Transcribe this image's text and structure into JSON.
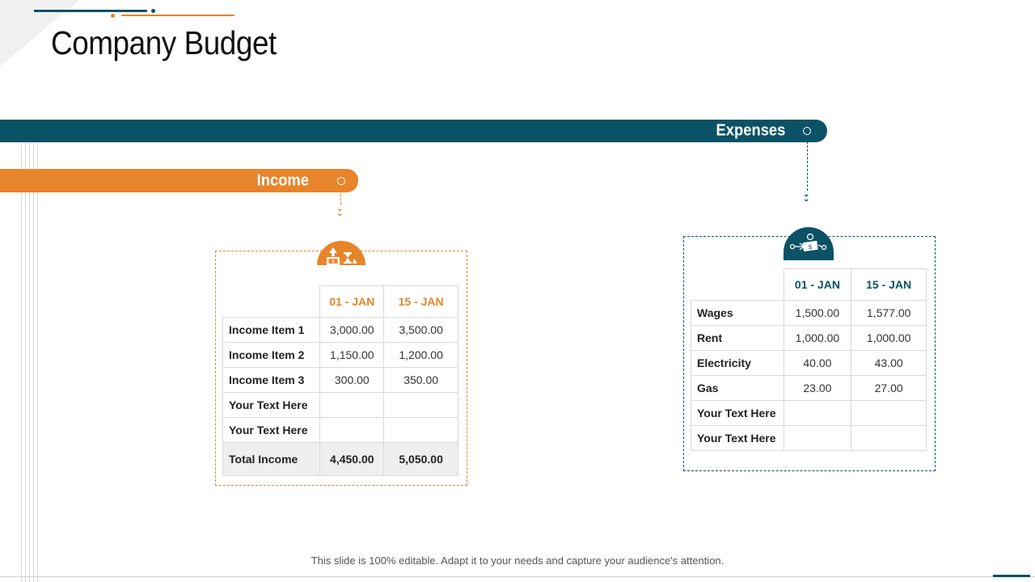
{
  "title": "Company Budget",
  "colors": {
    "teal": "#0b5266",
    "orange": "#e8842a"
  },
  "expenses": {
    "label": "Expenses",
    "icon": "money-flying-icon",
    "columns": [
      "01 - JAN",
      "15 - JAN"
    ],
    "rows": [
      {
        "label": "Wages",
        "values": [
          "1,500.00",
          "1,577.00"
        ]
      },
      {
        "label": "Rent",
        "values": [
          "1,000.00",
          "1,000.00"
        ]
      },
      {
        "label": "Electricity",
        "values": [
          "40.00",
          "43.00"
        ]
      },
      {
        "label": "Gas",
        "values": [
          "23.00",
          "27.00"
        ]
      },
      {
        "label": "Your Text Here",
        "values": [
          "",
          ""
        ]
      },
      {
        "label": "Your Text Here",
        "values": [
          "",
          ""
        ]
      }
    ]
  },
  "income": {
    "label": "Income",
    "icon": "money-growth-hourglass-icon",
    "columns": [
      "01 - JAN",
      "15 - JAN"
    ],
    "rows": [
      {
        "label": "Income Item 1",
        "values": [
          "3,000.00",
          "3,500.00"
        ]
      },
      {
        "label": "Income Item 2",
        "values": [
          "1,150.00",
          "1,200.00"
        ]
      },
      {
        "label": "Income Item 3",
        "values": [
          "300.00",
          "350.00"
        ]
      },
      {
        "label": "Your Text Here",
        "values": [
          "",
          ""
        ]
      },
      {
        "label": "Your Text Here",
        "values": [
          "",
          ""
        ]
      }
    ],
    "total": {
      "label": "Total Income",
      "values": [
        "4,450.00",
        "5,050.00"
      ]
    }
  },
  "footer": "This slide is 100% editable. Adapt it to your needs and capture your audience's attention."
}
